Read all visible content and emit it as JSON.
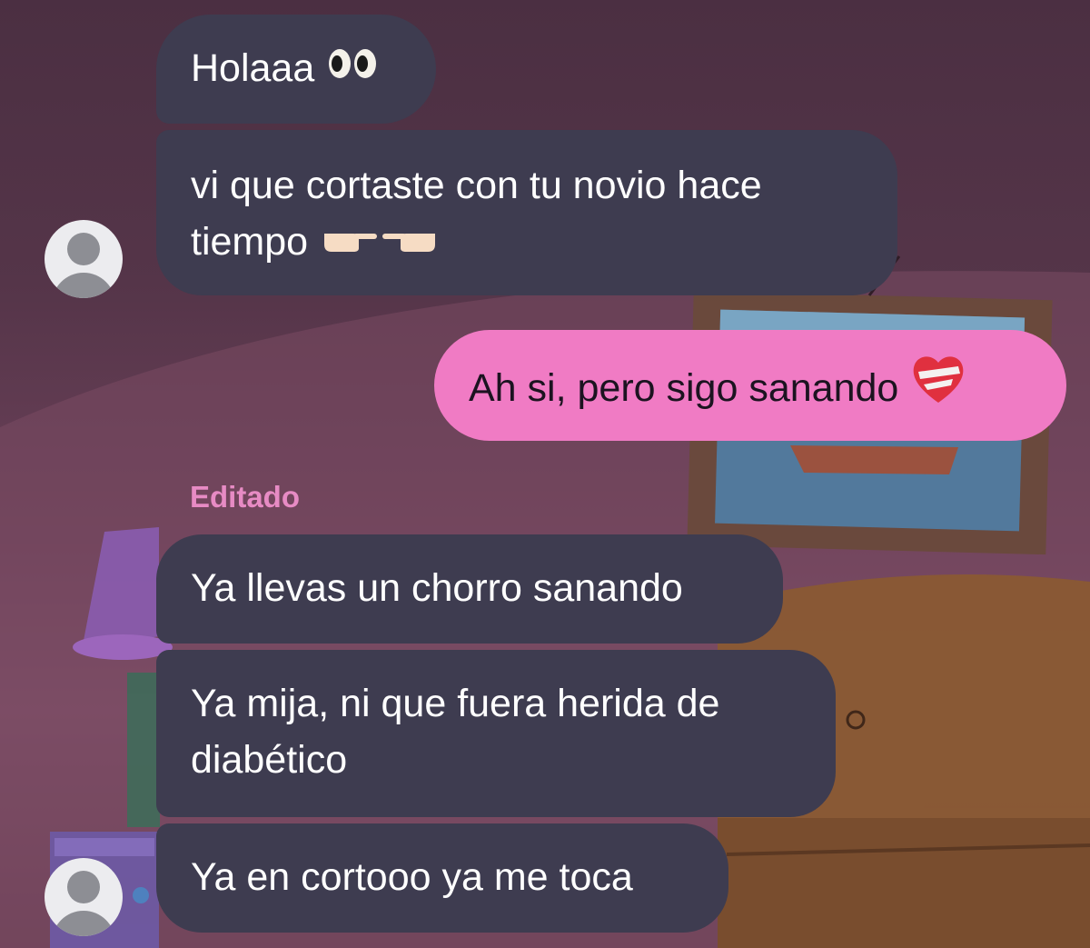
{
  "messages": [
    {
      "id": "m1",
      "side": "incoming",
      "text": "Holaaa",
      "emoji": "eyes-emoji"
    },
    {
      "id": "m2",
      "side": "incoming",
      "text_line1": "vi que cortaste con tu novio hace",
      "text_line2": "tiempo",
      "emoji": "pointing-fingers-emoji"
    },
    {
      "id": "m3",
      "side": "outgoing",
      "text": "Ah si, pero sigo sanando",
      "emoji": "mending-heart-emoji"
    },
    {
      "id": "m4",
      "side": "incoming",
      "edited_label": "Editado",
      "text": "Ya llevas un chorro sanando"
    },
    {
      "id": "m5",
      "side": "incoming",
      "text_line1": "Ya mija, ni que fuera herida de",
      "text_line2": "diabético"
    },
    {
      "id": "m6",
      "side": "incoming",
      "text": "Ya en cortooo ya me toca"
    }
  ],
  "colors": {
    "incoming_bubble": "#3e3c50",
    "outgoing_bubble": "#f07bc4",
    "edited_label": "#e78bc4",
    "background": "#553549"
  },
  "icons": [
    "default-avatar-icon",
    "eyes-emoji",
    "pointing-fingers-emoji",
    "mending-heart-emoji"
  ]
}
